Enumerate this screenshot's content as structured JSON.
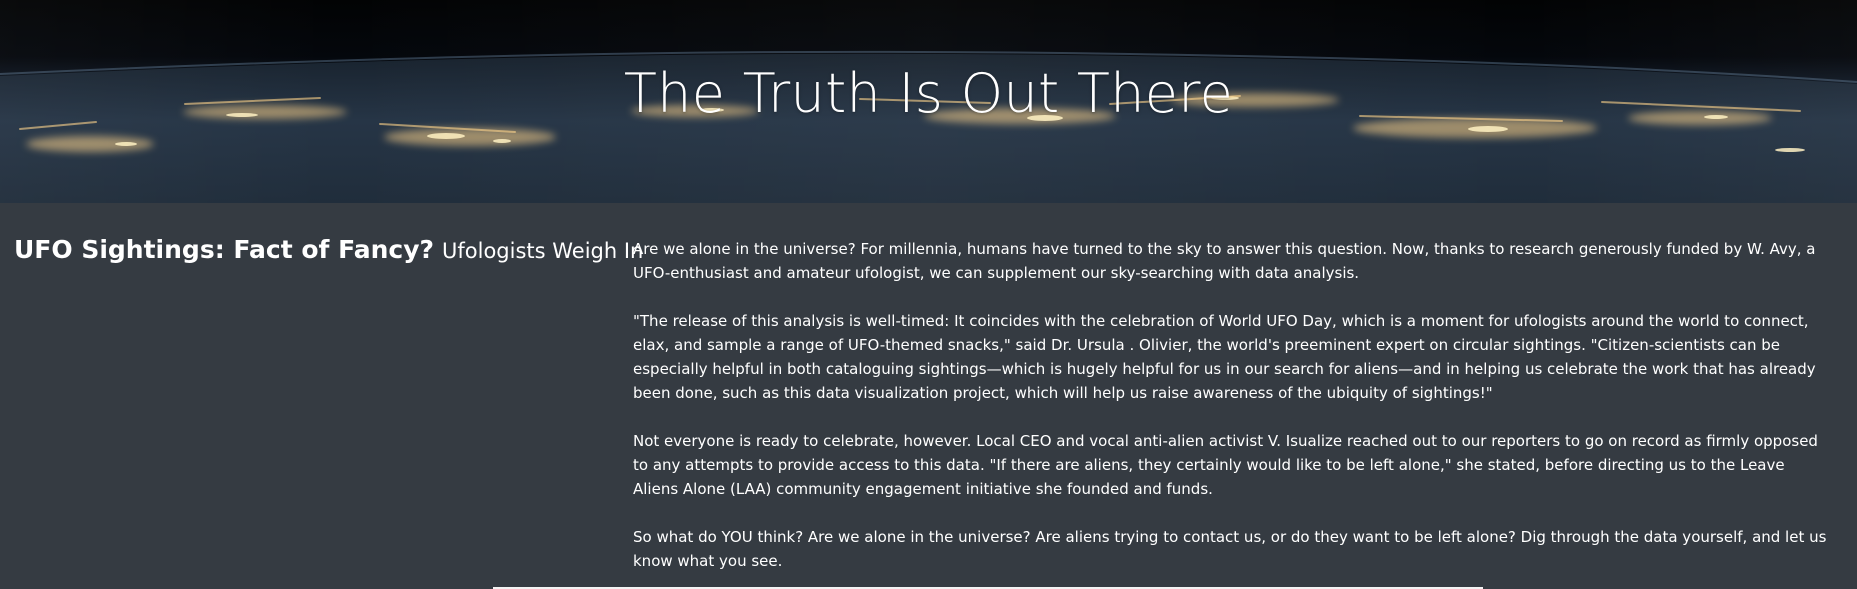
{
  "hero": {
    "title": "The Truth Is Out There"
  },
  "sidebar": {
    "headline": "UFO Sightings: Fact of Fancy?",
    "subheadline": "Ufologists Weigh In"
  },
  "article": {
    "paragraphs": [
      "Are we alone in the universe? For millennia, humans have turned to the sky to answer this question. Now, thanks to research generously funded by W. Avy, a UFO-enthusiast and amateur ufologist, we can supplement our sky-searching with data analysis.",
      "\"The release of this analysis is well-timed: It coincides with the celebration of World UFO Day, which is a moment for ufologists around the world to connect, elax, and sample a range of UFO-themed snacks,\" said Dr. Ursula . Olivier, the world's preeminent expert on circular sightings. \"Citizen-scientists can be especially helpful in both cataloguing sightings—which is hugely helpful for us in our search for aliens—and in helping us celebrate the work that has already been done, such as this data visualization project, which will help us raise awareness of the ubiquity of sightings!\"",
      "Not everyone is ready to celebrate, however. Local CEO and vocal anti-alien activist V. Isualize reached out to our reporters to go on record as firmly opposed to any attempts to provide access to this data. \"If there are aliens, they certainly would like to be left alone,\" she stated, before directing us to the Leave Aliens Alone (LAA) community engagement initiative she founded and funds.",
      "So what do YOU think? Are we alone in the universe? Are aliens trying to contact us, or do they want to be left alone? Dig through the data yourself, and let us know what you see."
    ]
  },
  "colors": {
    "background": "#353b42",
    "hero_sky": "#04070c",
    "city_light": "#ffd48a",
    "text": "#ffffff"
  },
  "icons": {
    "hero_image": "earth-at-night-image"
  }
}
